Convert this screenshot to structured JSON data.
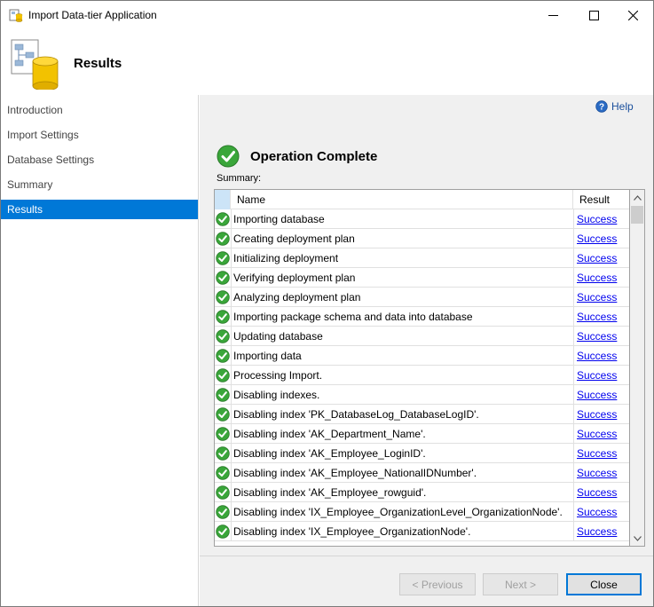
{
  "window": {
    "title": "Import Data-tier Application"
  },
  "header": {
    "title": "Results"
  },
  "sidebar": {
    "items": [
      {
        "label": "Introduction",
        "active": false
      },
      {
        "label": "Import Settings",
        "active": false
      },
      {
        "label": "Database Settings",
        "active": false
      },
      {
        "label": "Summary",
        "active": false
      },
      {
        "label": "Results",
        "active": true
      }
    ]
  },
  "content": {
    "help_label": "Help",
    "operation_title": "Operation Complete",
    "summary_label": "Summary:",
    "columns": {
      "name": "Name",
      "result": "Result"
    },
    "rows": [
      {
        "name": "Importing database",
        "result": "Success"
      },
      {
        "name": "Creating deployment plan",
        "result": "Success"
      },
      {
        "name": "Initializing deployment",
        "result": "Success"
      },
      {
        "name": "Verifying deployment plan",
        "result": "Success"
      },
      {
        "name": "Analyzing deployment plan",
        "result": "Success"
      },
      {
        "name": "Importing package schema and data into database",
        "result": "Success"
      },
      {
        "name": "Updating database",
        "result": "Success"
      },
      {
        "name": "Importing data",
        "result": "Success"
      },
      {
        "name": "Processing Import.",
        "result": "Success"
      },
      {
        "name": "Disabling indexes.",
        "result": "Success"
      },
      {
        "name": "Disabling index 'PK_DatabaseLog_DatabaseLogID'.",
        "result": "Success"
      },
      {
        "name": "Disabling index 'AK_Department_Name'.",
        "result": "Success"
      },
      {
        "name": "Disabling index 'AK_Employee_LoginID'.",
        "result": "Success"
      },
      {
        "name": "Disabling index 'AK_Employee_NationalIDNumber'.",
        "result": "Success"
      },
      {
        "name": "Disabling index 'AK_Employee_rowguid'.",
        "result": "Success"
      },
      {
        "name": "Disabling index 'IX_Employee_OrganizationLevel_OrganizationNode'.",
        "result": "Success"
      },
      {
        "name": "Disabling index 'IX_Employee_OrganizationNode'.",
        "result": "Success"
      }
    ]
  },
  "footer": {
    "previous_label": "< Previous",
    "next_label": "Next >",
    "close_label": "Close"
  },
  "colors": {
    "accent": "#0078d7",
    "success_green": "#3aa63a",
    "link": "#0000ee"
  }
}
